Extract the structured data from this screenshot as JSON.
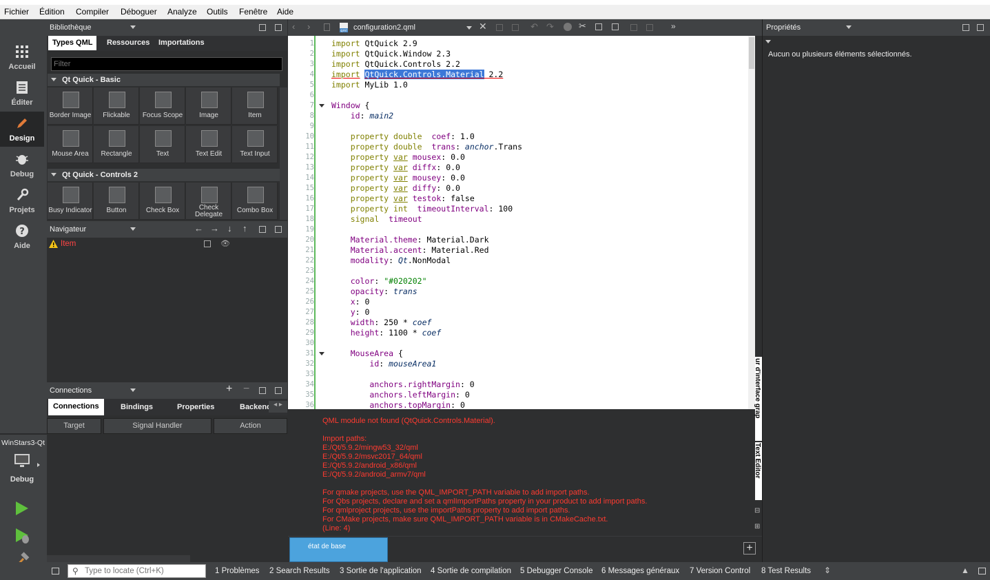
{
  "menubar": {
    "items": [
      "Fichier",
      "Édition",
      "Compiler",
      "Déboguer",
      "Analyze",
      "Outils",
      "Fenêtre",
      "Aide"
    ]
  },
  "modes": [
    {
      "label": "Accueil",
      "icon": "grid-icon"
    },
    {
      "label": "Éditer",
      "icon": "document-icon"
    },
    {
      "label": "Design",
      "icon": "pencil-icon"
    },
    {
      "label": "Debug",
      "icon": "bug-icon"
    },
    {
      "label": "Projets",
      "icon": "wrench-icon"
    },
    {
      "label": "Aide",
      "icon": "help-icon"
    }
  ],
  "kit": {
    "project": "WinStars3-Qt",
    "config": "Debug"
  },
  "library": {
    "title": "Bibliothèque",
    "tabs": [
      "Types QML",
      "Ressources",
      "Importations"
    ],
    "filter_placeholder": "Filter",
    "sections": [
      {
        "title": "Qt Quick - Basic",
        "items": [
          "Border Image",
          "Flickable",
          "Focus Scope",
          "Image",
          "Item",
          "Mouse Area",
          "Rectangle",
          "Text",
          "Text Edit",
          "Text Input"
        ]
      },
      {
        "title": "Qt Quick - Controls 2",
        "items": [
          "Busy Indicator",
          "Button",
          "Check Box",
          "Check Delegate",
          "Combo Box"
        ]
      }
    ]
  },
  "navigator": {
    "title": "Navigateur",
    "item": "Item"
  },
  "connections": {
    "title": "Connections",
    "tabs": [
      "Connections",
      "Bindings",
      "Properties",
      "Backend"
    ],
    "columns": [
      "Target",
      "Signal Handler",
      "Action"
    ]
  },
  "editor": {
    "file": "configuration2.qml",
    "file_icon_label": "qml",
    "side_label": "Text Editor",
    "side_label2": "ur d'interface grap",
    "lines": [
      {
        "n": 1,
        "segs": [
          [
            "kw",
            "import"
          ],
          [
            "",
            "QtQuick 2.9"
          ]
        ]
      },
      {
        "n": 2,
        "segs": [
          [
            "kw",
            "import"
          ],
          [
            "",
            "QtQuick.Window 2.3"
          ]
        ]
      },
      {
        "n": 3,
        "segs": [
          [
            "kw",
            "import"
          ],
          [
            "",
            "QtQuick.Controls 2.2"
          ]
        ]
      },
      {
        "n": 4,
        "segs": [
          [
            "kwr",
            "import"
          ],
          [
            "sp",
            " "
          ],
          [
            "hl",
            "QtQuick.Controls.Material"
          ],
          [
            "red",
            " 2.2"
          ]
        ]
      },
      {
        "n": 5,
        "segs": [
          [
            "kw",
            "import"
          ],
          [
            "",
            "MyLib 1.0"
          ]
        ]
      },
      {
        "n": 6,
        "segs": []
      },
      {
        "n": 7,
        "segs": [
          [
            "ty",
            "Window"
          ],
          [
            "",
            " {"
          ]
        ]
      },
      {
        "n": 8,
        "segs": [
          [
            "",
            "    "
          ],
          [
            "ty",
            "id"
          ],
          [
            "",
            ": "
          ],
          [
            "it",
            "main2"
          ]
        ]
      },
      {
        "n": 9,
        "segs": []
      },
      {
        "n": 10,
        "segs": [
          [
            "",
            "    "
          ],
          [
            "kw",
            "property double"
          ],
          [
            "",
            " "
          ],
          [
            "ty",
            "coef"
          ],
          [
            "",
            ": 1.0"
          ]
        ]
      },
      {
        "n": 11,
        "segs": [
          [
            "",
            "    "
          ],
          [
            "kw",
            "property double"
          ],
          [
            "",
            " "
          ],
          [
            "ty",
            "trans"
          ],
          [
            "",
            ": "
          ],
          [
            "it",
            "anchor"
          ],
          [
            "",
            ".Trans"
          ]
        ]
      },
      {
        "n": 12,
        "segs": [
          [
            "",
            "    "
          ],
          [
            "kw",
            "property "
          ],
          [
            "kwu",
            "var"
          ],
          [
            "",
            " "
          ],
          [
            "ty",
            "mousex"
          ],
          [
            "",
            ": 0.0"
          ]
        ]
      },
      {
        "n": 13,
        "segs": [
          [
            "",
            "    "
          ],
          [
            "kw",
            "property "
          ],
          [
            "kwu",
            "var"
          ],
          [
            "",
            " "
          ],
          [
            "ty",
            "diffx"
          ],
          [
            "",
            ": 0.0"
          ]
        ]
      },
      {
        "n": 14,
        "segs": [
          [
            "",
            "    "
          ],
          [
            "kw",
            "property "
          ],
          [
            "kwu",
            "var"
          ],
          [
            "",
            " "
          ],
          [
            "ty",
            "mousey"
          ],
          [
            "",
            ": 0.0"
          ]
        ]
      },
      {
        "n": 15,
        "segs": [
          [
            "",
            "    "
          ],
          [
            "kw",
            "property "
          ],
          [
            "kwu",
            "var"
          ],
          [
            "",
            " "
          ],
          [
            "ty",
            "diffy"
          ],
          [
            "",
            ": 0.0"
          ]
        ]
      },
      {
        "n": 16,
        "segs": [
          [
            "",
            "    "
          ],
          [
            "kw",
            "property "
          ],
          [
            "kwu",
            "var"
          ],
          [
            "",
            " "
          ],
          [
            "ty",
            "testok"
          ],
          [
            "",
            ": false"
          ]
        ]
      },
      {
        "n": 17,
        "segs": [
          [
            "",
            "    "
          ],
          [
            "kw",
            "property int"
          ],
          [
            "",
            " "
          ],
          [
            "ty",
            "timeoutInterval"
          ],
          [
            "",
            ": 100"
          ]
        ]
      },
      {
        "n": 18,
        "segs": [
          [
            "",
            "    "
          ],
          [
            "kw",
            "signal"
          ],
          [
            "",
            " "
          ],
          [
            "ty",
            "timeout"
          ]
        ]
      },
      {
        "n": 19,
        "segs": []
      },
      {
        "n": 20,
        "segs": [
          [
            "",
            "    "
          ],
          [
            "ty",
            "Material.theme"
          ],
          [
            "",
            ": Material.Dark"
          ]
        ]
      },
      {
        "n": 21,
        "segs": [
          [
            "",
            "    "
          ],
          [
            "ty",
            "Material.accent"
          ],
          [
            "",
            ": Material.Red"
          ]
        ]
      },
      {
        "n": 22,
        "segs": [
          [
            "",
            "    "
          ],
          [
            "ty",
            "modality"
          ],
          [
            "",
            ": "
          ],
          [
            "it",
            "Qt"
          ],
          [
            "",
            ".NonModal"
          ]
        ]
      },
      {
        "n": 23,
        "segs": []
      },
      {
        "n": 24,
        "segs": [
          [
            "",
            "    "
          ],
          [
            "ty",
            "color"
          ],
          [
            "",
            ": "
          ],
          [
            "str",
            "\"#020202\""
          ]
        ]
      },
      {
        "n": 25,
        "segs": [
          [
            "",
            "    "
          ],
          [
            "ty",
            "opacity"
          ],
          [
            "",
            ": "
          ],
          [
            "it",
            "trans"
          ]
        ]
      },
      {
        "n": 26,
        "segs": [
          [
            "",
            "    "
          ],
          [
            "ty",
            "x"
          ],
          [
            "",
            ": 0"
          ]
        ]
      },
      {
        "n": 27,
        "segs": [
          [
            "",
            "    "
          ],
          [
            "ty",
            "y"
          ],
          [
            "",
            ": 0"
          ]
        ]
      },
      {
        "n": 28,
        "segs": [
          [
            "",
            "    "
          ],
          [
            "ty",
            "width"
          ],
          [
            "",
            ": 250 * "
          ],
          [
            "it",
            "coef"
          ]
        ]
      },
      {
        "n": 29,
        "segs": [
          [
            "",
            "    "
          ],
          [
            "ty",
            "height"
          ],
          [
            "",
            ": 1100 * "
          ],
          [
            "it",
            "coef"
          ]
        ]
      },
      {
        "n": 30,
        "segs": []
      },
      {
        "n": 31,
        "segs": [
          [
            "",
            "    "
          ],
          [
            "ty",
            "MouseArea"
          ],
          [
            "",
            " {"
          ]
        ]
      },
      {
        "n": 32,
        "segs": [
          [
            "",
            "        "
          ],
          [
            "ty",
            "id"
          ],
          [
            "",
            ": "
          ],
          [
            "it",
            "mouseArea1"
          ]
        ]
      },
      {
        "n": 33,
        "segs": []
      },
      {
        "n": 34,
        "segs": [
          [
            "",
            "        "
          ],
          [
            "ty",
            "anchors.rightMargin"
          ],
          [
            "",
            ": 0"
          ]
        ]
      },
      {
        "n": 35,
        "segs": [
          [
            "",
            "        "
          ],
          [
            "ty",
            "anchors.leftMargin"
          ],
          [
            "",
            ": 0"
          ]
        ]
      },
      {
        "n": 36,
        "segs": [
          [
            "",
            "        "
          ],
          [
            "ty",
            "anchors.topMargin"
          ],
          [
            "",
            ": 0"
          ]
        ]
      }
    ]
  },
  "errors": [
    "QML module not found (QtQuick.Controls.Material).",
    "",
    "Import paths:",
    "E:/Qt/5.9.2/mingw53_32/qml",
    "E:/Qt/5.9.2/msvc2017_64/qml",
    "E:/Qt/5.9.2/android_x86/qml",
    "E:/Qt/5.9.2/android_armv7/qml",
    "",
    "For qmake projects, use the QML_IMPORT_PATH variable to add import paths.",
    "For Qbs projects, declare and set a qmlImportPaths property in your product to add import paths.",
    "For qmlproject projects, use the importPaths property to add import paths.",
    "For CMake projects, make sure QML_IMPORT_PATH variable is in CMakeCache.txt.",
    "  (Line: 4)"
  ],
  "states": {
    "base_label": "état de base"
  },
  "properties": {
    "title": "Propriétés",
    "message": "Aucun ou plusieurs éléments sélectionnés."
  },
  "statusbar": {
    "locate_placeholder": "Type to locate (Ctrl+K)",
    "items": [
      "1  Problèmes",
      "2  Search Results",
      "3  Sortie de l'application",
      "4  Sortie de compilation",
      "5  Debugger Console",
      "6  Messages généraux",
      "7  Version Control",
      "8  Test Results"
    ]
  },
  "colors": {
    "accent": "#4ca3dd",
    "error": "#ff3b30",
    "highlight": "#3c78d8",
    "active_mode": "#262728",
    "success_bar": "#5bb85a"
  }
}
